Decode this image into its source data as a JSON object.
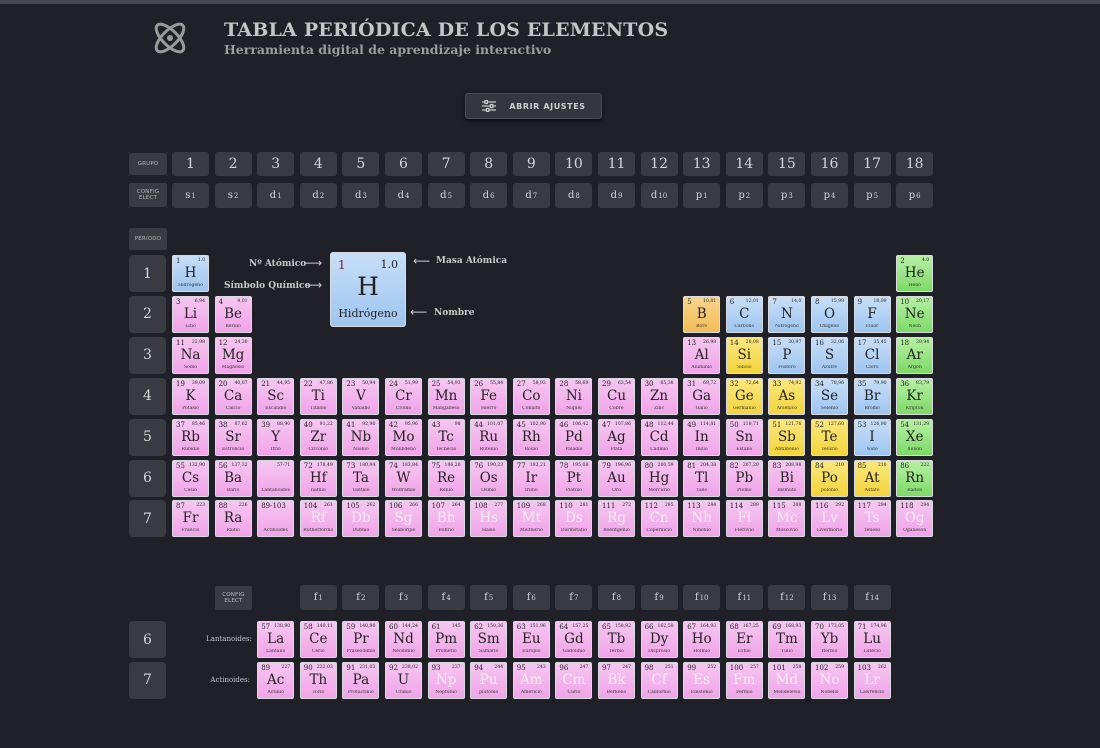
{
  "header": {
    "title": "TABLA PERIÓDICA DE LOS ELEMENTOS",
    "subtitle": "Herramienta digital de aprendizaje interactivo",
    "logo_icon": "atom-icon"
  },
  "settings_button": {
    "label": "ABRIR AJUSTES",
    "icon": "sliders-icon"
  },
  "labels": {
    "grupo": "GRUPO",
    "config_elect": "CONFIG ELECT",
    "periodo": "PERIODO",
    "lantanoides": "Lantanoides:",
    "actinoides": "Actinoides:"
  },
  "groups": [
    "1",
    "2",
    "3",
    "4",
    "5",
    "6",
    "7",
    "8",
    "9",
    "10",
    "11",
    "12",
    "13",
    "14",
    "15",
    "16",
    "17",
    "18"
  ],
  "group_configs": [
    [
      "s",
      "1"
    ],
    [
      "s",
      "2"
    ],
    [
      "d",
      "1"
    ],
    [
      "d",
      "2"
    ],
    [
      "d",
      "3"
    ],
    [
      "d",
      "4"
    ],
    [
      "d",
      "5"
    ],
    [
      "d",
      "6"
    ],
    [
      "d",
      "7"
    ],
    [
      "d",
      "8"
    ],
    [
      "d",
      "9"
    ],
    [
      "d",
      "10"
    ],
    [
      "p",
      "1"
    ],
    [
      "p",
      "2"
    ],
    [
      "p",
      "3"
    ],
    [
      "p",
      "4"
    ],
    [
      "p",
      "5"
    ],
    [
      "p",
      "6"
    ]
  ],
  "f_configs": [
    [
      "f",
      "1"
    ],
    [
      "f",
      "2"
    ],
    [
      "f",
      "3"
    ],
    [
      "f",
      "4"
    ],
    [
      "f",
      "5"
    ],
    [
      "f",
      "6"
    ],
    [
      "f",
      "7"
    ],
    [
      "f",
      "8"
    ],
    [
      "f",
      "9"
    ],
    [
      "f",
      "10"
    ],
    [
      "f",
      "11"
    ],
    [
      "f",
      "12"
    ],
    [
      "f",
      "13"
    ],
    [
      "f",
      "14"
    ]
  ],
  "periods": [
    "1",
    "2",
    "3",
    "4",
    "5",
    "6",
    "7"
  ],
  "series_periods": [
    "6",
    "7"
  ],
  "legend": {
    "example": {
      "number": "1",
      "mass": "1.0",
      "symbol": "H",
      "name": "Hidrógeno"
    },
    "atomic_number_label": "Nº Atómico",
    "symbol_label": "Símbolo Químico",
    "mass_label": "Masa Atómica",
    "name_label": "Nombre"
  },
  "colors": {
    "background": "#1f2028",
    "header_cell": "#3a3b42",
    "pink": "#f0a4e8",
    "blue": "#9ec5f0",
    "orange": "#f3bd55",
    "yellow": "#f3d53c",
    "green": "#7ed967"
  },
  "elements": [
    [
      "1",
      "1.0",
      "H",
      "Hidrógeno",
      1,
      1,
      "blue",
      0
    ],
    [
      "2",
      "4.0",
      "He",
      "Helio",
      1,
      18,
      "green",
      0
    ],
    [
      "3",
      "6,94",
      "Li",
      "Litio",
      2,
      1,
      "pink",
      0
    ],
    [
      "4",
      "9,01",
      "Be",
      "Berilio",
      2,
      2,
      "pink",
      0
    ],
    [
      "5",
      "10,81",
      "B",
      "Boro",
      2,
      13,
      "orange",
      0
    ],
    [
      "6",
      "12,01",
      "C",
      "Carbono",
      2,
      14,
      "blue",
      0
    ],
    [
      "7",
      "14,0",
      "N",
      "Nitrógeno",
      2,
      15,
      "blue",
      0
    ],
    [
      "8",
      "15,99",
      "O",
      "Oxígeno",
      2,
      16,
      "blue",
      0
    ],
    [
      "9",
      "18,99",
      "F",
      "Flúor",
      2,
      17,
      "blue",
      0
    ],
    [
      "10",
      "20,17",
      "Ne",
      "Neón",
      2,
      18,
      "green",
      0
    ],
    [
      "11",
      "22,98",
      "Na",
      "Sodio",
      3,
      1,
      "pink",
      0
    ],
    [
      "12",
      "24,30",
      "Mg",
      "Magnesio",
      3,
      2,
      "pink",
      0
    ],
    [
      "13",
      "26,98",
      "Al",
      "Aluminio",
      3,
      13,
      "pink",
      0
    ],
    [
      "14",
      "28,08",
      "Si",
      "Silicio",
      3,
      14,
      "yellow",
      0
    ],
    [
      "15",
      "30,97",
      "P",
      "Fósforo",
      3,
      15,
      "blue",
      0
    ],
    [
      "16",
      "32,06",
      "S",
      "Azufre",
      3,
      16,
      "blue",
      0
    ],
    [
      "17",
      "35,45",
      "Cl",
      "Cloro",
      3,
      17,
      "blue",
      0
    ],
    [
      "18",
      "39,94",
      "Ar",
      "Argón",
      3,
      18,
      "green",
      0
    ],
    [
      "19",
      "39,09",
      "K",
      "Potasio",
      4,
      1,
      "pink",
      0
    ],
    [
      "20",
      "40,07",
      "Ca",
      "Calcio",
      4,
      2,
      "pink",
      0
    ],
    [
      "21",
      "44,95",
      "Sc",
      "Escandio",
      4,
      3,
      "pink",
      0
    ],
    [
      "22",
      "47,86",
      "Ti",
      "Titanio",
      4,
      4,
      "pink",
      0
    ],
    [
      "23",
      "50,94",
      "V",
      "Vanadio",
      4,
      5,
      "pink",
      0
    ],
    [
      "24",
      "51,99",
      "Cr",
      "Cromo",
      4,
      6,
      "pink",
      0
    ],
    [
      "25",
      "54,93",
      "Mn",
      "Manganeso",
      4,
      7,
      "pink",
      0
    ],
    [
      "26",
      "55,84",
      "Fe",
      "Hierro",
      4,
      8,
      "pink",
      0
    ],
    [
      "27",
      "58,93",
      "Co",
      "Cobalto",
      4,
      9,
      "pink",
      0
    ],
    [
      "28",
      "58,69",
      "Ni",
      "Níquel",
      4,
      10,
      "pink",
      0
    ],
    [
      "29",
      "63,54",
      "Cu",
      "Cobre",
      4,
      11,
      "pink",
      0
    ],
    [
      "30",
      "65,38",
      "Zn",
      "Zinc",
      4,
      12,
      "pink",
      0
    ],
    [
      "31",
      "69,72",
      "Ga",
      "Galio",
      4,
      13,
      "pink",
      0
    ],
    [
      "32",
      "72,64",
      "Ge",
      "Germanio",
      4,
      14,
      "yellow",
      0
    ],
    [
      "33",
      "74,92",
      "As",
      "Arsénico",
      4,
      15,
      "yellow",
      0
    ],
    [
      "34",
      "78,96",
      "Se",
      "Selenio",
      4,
      16,
      "blue",
      0
    ],
    [
      "35",
      "79,90",
      "Br",
      "Bromo",
      4,
      17,
      "blue",
      0
    ],
    [
      "36",
      "83,79",
      "Kr",
      "Kriptón",
      4,
      18,
      "green",
      0
    ],
    [
      "37",
      "85,46",
      "Rb",
      "Rubidio",
      5,
      1,
      "pink",
      0
    ],
    [
      "38",
      "87,62",
      "Sr",
      "Estroncio",
      5,
      2,
      "pink",
      0
    ],
    [
      "39",
      "88,90",
      "Y",
      "Itrio",
      5,
      3,
      "pink",
      0
    ],
    [
      "40",
      "91,22",
      "Zr",
      "Circonio",
      5,
      4,
      "pink",
      0
    ],
    [
      "41",
      "92,90",
      "Nb",
      "Niobio",
      5,
      5,
      "pink",
      0
    ],
    [
      "42",
      "95,96",
      "Mo",
      "Molibdeno",
      5,
      6,
      "pink",
      0
    ],
    [
      "43",
      "98",
      "Tc",
      "Tecnecio",
      5,
      7,
      "pink",
      0
    ],
    [
      "44",
      "101,07",
      "Ru",
      "Rutenio",
      5,
      8,
      "pink",
      0
    ],
    [
      "45",
      "102,90",
      "Rh",
      "Rodio",
      5,
      9,
      "pink",
      0
    ],
    [
      "46",
      "106,42",
      "Pd",
      "Paladio",
      5,
      10,
      "pink",
      0
    ],
    [
      "47",
      "107,86",
      "Ag",
      "Plata",
      5,
      11,
      "pink",
      0
    ],
    [
      "48",
      "112,44",
      "Cd",
      "Cadmio",
      5,
      12,
      "pink",
      0
    ],
    [
      "49",
      "114,81",
      "In",
      "Indio",
      5,
      13,
      "pink",
      0
    ],
    [
      "50",
      "118,71",
      "Sn",
      "Estaño",
      5,
      14,
      "pink",
      0
    ],
    [
      "51",
      "121,76",
      "Sb",
      "Antimonio",
      5,
      15,
      "yellow",
      0
    ],
    [
      "52",
      "127,60",
      "Te",
      "Telurio",
      5,
      16,
      "yellow",
      0
    ],
    [
      "53",
      "126,90",
      "I",
      "Yodo",
      5,
      17,
      "blue",
      0
    ],
    [
      "54",
      "131,29",
      "Xe",
      "Xenón",
      5,
      18,
      "green",
      0
    ],
    [
      "55",
      "132,90",
      "Cs",
      "Cesio",
      6,
      1,
      "pink",
      0
    ],
    [
      "56",
      "137,32",
      "Ba",
      "Bario",
      6,
      2,
      "pink",
      0
    ],
    [
      "",
      "57-71",
      "",
      "Lantanoides",
      6,
      3,
      "pink",
      0
    ],
    [
      "72",
      "178,49",
      "Hf",
      "hafnio",
      6,
      4,
      "pink",
      0
    ],
    [
      "73",
      "180,94",
      "Ta",
      "Tántalo",
      6,
      5,
      "pink",
      0
    ],
    [
      "74",
      "183,84",
      "W",
      "Wolframio",
      6,
      6,
      "pink",
      0
    ],
    [
      "75",
      "186,20",
      "Re",
      "Renio",
      6,
      7,
      "pink",
      0
    ],
    [
      "76",
      "190,23",
      "Os",
      "Osmio",
      6,
      8,
      "pink",
      0
    ],
    [
      "77",
      "192,21",
      "Ir",
      "Iridio",
      6,
      9,
      "pink",
      0
    ],
    [
      "78",
      "195,08",
      "Pt",
      "Platino",
      6,
      10,
      "pink",
      0
    ],
    [
      "79",
      "196,96",
      "Au",
      "Oro",
      6,
      11,
      "pink",
      0
    ],
    [
      "80",
      "200,59",
      "Hg",
      "Mercurio",
      6,
      12,
      "pink",
      0
    ],
    [
      "81",
      "204,38",
      "Tl",
      "Talio",
      6,
      13,
      "pink",
      0
    ],
    [
      "82",
      "207,20",
      "Pb",
      "Plomo",
      6,
      14,
      "pink",
      0
    ],
    [
      "83",
      "208,98",
      "Bi",
      "Bismuto",
      6,
      15,
      "pink",
      0
    ],
    [
      "84",
      "210",
      "Po",
      "polonio",
      6,
      16,
      "yellow",
      0
    ],
    [
      "85",
      "210",
      "At",
      "Astato",
      6,
      17,
      "yellow",
      0
    ],
    [
      "86",
      "222",
      "Rn",
      "Radón",
      6,
      18,
      "green",
      0
    ],
    [
      "87",
      "223",
      "Fr",
      "Francio",
      7,
      1,
      "pink",
      0
    ],
    [
      "88",
      "226",
      "Ra",
      "Radio",
      7,
      2,
      "pink",
      0
    ],
    [
      "89-103",
      "",
      "",
      "Actinoides",
      7,
      3,
      "pink",
      0
    ],
    [
      "104",
      "261",
      "Rf",
      "Rutherfordio",
      7,
      4,
      "pink",
      1
    ],
    [
      "105",
      "262",
      "Db",
      "Dubnio",
      7,
      5,
      "pink",
      1
    ],
    [
      "106",
      "266",
      "Sg",
      "Seaborgio",
      7,
      6,
      "pink",
      1
    ],
    [
      "107",
      "264",
      "Bh",
      "Bohrio",
      7,
      7,
      "pink",
      1
    ],
    [
      "108",
      "277",
      "Hs",
      "Hasio",
      7,
      8,
      "pink",
      1
    ],
    [
      "109",
      "268",
      "Mt",
      "Meitnerio",
      7,
      9,
      "pink",
      1
    ],
    [
      "110",
      "281",
      "Ds",
      "Darmstatio",
      7,
      10,
      "pink",
      1
    ],
    [
      "111",
      "272",
      "Rg",
      "Roentgenio",
      7,
      11,
      "pink",
      1
    ],
    [
      "112",
      "285",
      "Cn",
      "Copernicio",
      7,
      12,
      "pink",
      1
    ],
    [
      "113",
      "284",
      "Nh",
      "Nihonio",
      7,
      13,
      "pink",
      1
    ],
    [
      "114",
      "289",
      "Fl",
      "Flerovio",
      7,
      14,
      "pink",
      1
    ],
    [
      "115",
      "288",
      "Mc",
      "Moscovio",
      7,
      15,
      "pink",
      1
    ],
    [
      "116",
      "292",
      "Lv",
      "Livermorio",
      7,
      16,
      "pink",
      1
    ],
    [
      "117",
      "294",
      "Ts",
      "Teneso",
      7,
      17,
      "pink",
      1
    ],
    [
      "118",
      "294",
      "Og",
      "Oganesón",
      7,
      18,
      "pink",
      1
    ]
  ],
  "lanthanides": [
    [
      "57",
      "138,90",
      "La",
      "Lantano",
      0
    ],
    [
      "58",
      "140,11",
      "Ce",
      "Cerio",
      0
    ],
    [
      "59",
      "140,90",
      "Pr",
      "Praseodimio",
      0
    ],
    [
      "60",
      "144,24",
      "Nd",
      "Neodimio",
      0
    ],
    [
      "61",
      "145",
      "Pm",
      "Prometio",
      0
    ],
    [
      "62",
      "150,36",
      "Sm",
      "Samario",
      0
    ],
    [
      "63",
      "151,96",
      "Eu",
      "Europio",
      0
    ],
    [
      "64",
      "157,25",
      "Gd",
      "Gadolinio",
      0
    ],
    [
      "65",
      "158,92",
      "Tb",
      "Terbio",
      0
    ],
    [
      "66",
      "162,50",
      "Dy",
      "Disprosio",
      0
    ],
    [
      "67",
      "164,93",
      "Ho",
      "Holmio",
      0
    ],
    [
      "68",
      "167,25",
      "Er",
      "Erbio",
      0
    ],
    [
      "69",
      "168,93",
      "Tm",
      "Tulio",
      0
    ],
    [
      "70",
      "173,05",
      "Yb",
      "Iterbio",
      0
    ],
    [
      "71",
      "174,96",
      "Lu",
      "Lutecio",
      0
    ]
  ],
  "actinides": [
    [
      "89",
      "227",
      "Ac",
      "Actinio",
      0
    ],
    [
      "90",
      "232,03",
      "Th",
      "Torio",
      0
    ],
    [
      "91",
      "231,03",
      "Pa",
      "Protactinio",
      0
    ],
    [
      "92",
      "238,02",
      "U",
      "Uranio",
      0
    ],
    [
      "93",
      "237",
      "Np",
      "Neptunio",
      1
    ],
    [
      "94",
      "244",
      "Pu",
      "plutonio",
      1
    ],
    [
      "95",
      "243",
      "Am",
      "Americio",
      1
    ],
    [
      "96",
      "247",
      "Cm",
      "Curio",
      1
    ],
    [
      "97",
      "247",
      "Bk",
      "Berkelio",
      1
    ],
    [
      "98",
      "251",
      "Cf",
      "Californio",
      1
    ],
    [
      "99",
      "252",
      "Es",
      "Einstenio",
      1
    ],
    [
      "100",
      "257",
      "Fm",
      "Fermio",
      1
    ],
    [
      "101",
      "258",
      "Md",
      "Mendelevio",
      1
    ],
    [
      "102",
      "259",
      "No",
      "Nobelio",
      1
    ],
    [
      "103",
      "262",
      "Lr",
      "Lawrencio",
      1
    ]
  ]
}
